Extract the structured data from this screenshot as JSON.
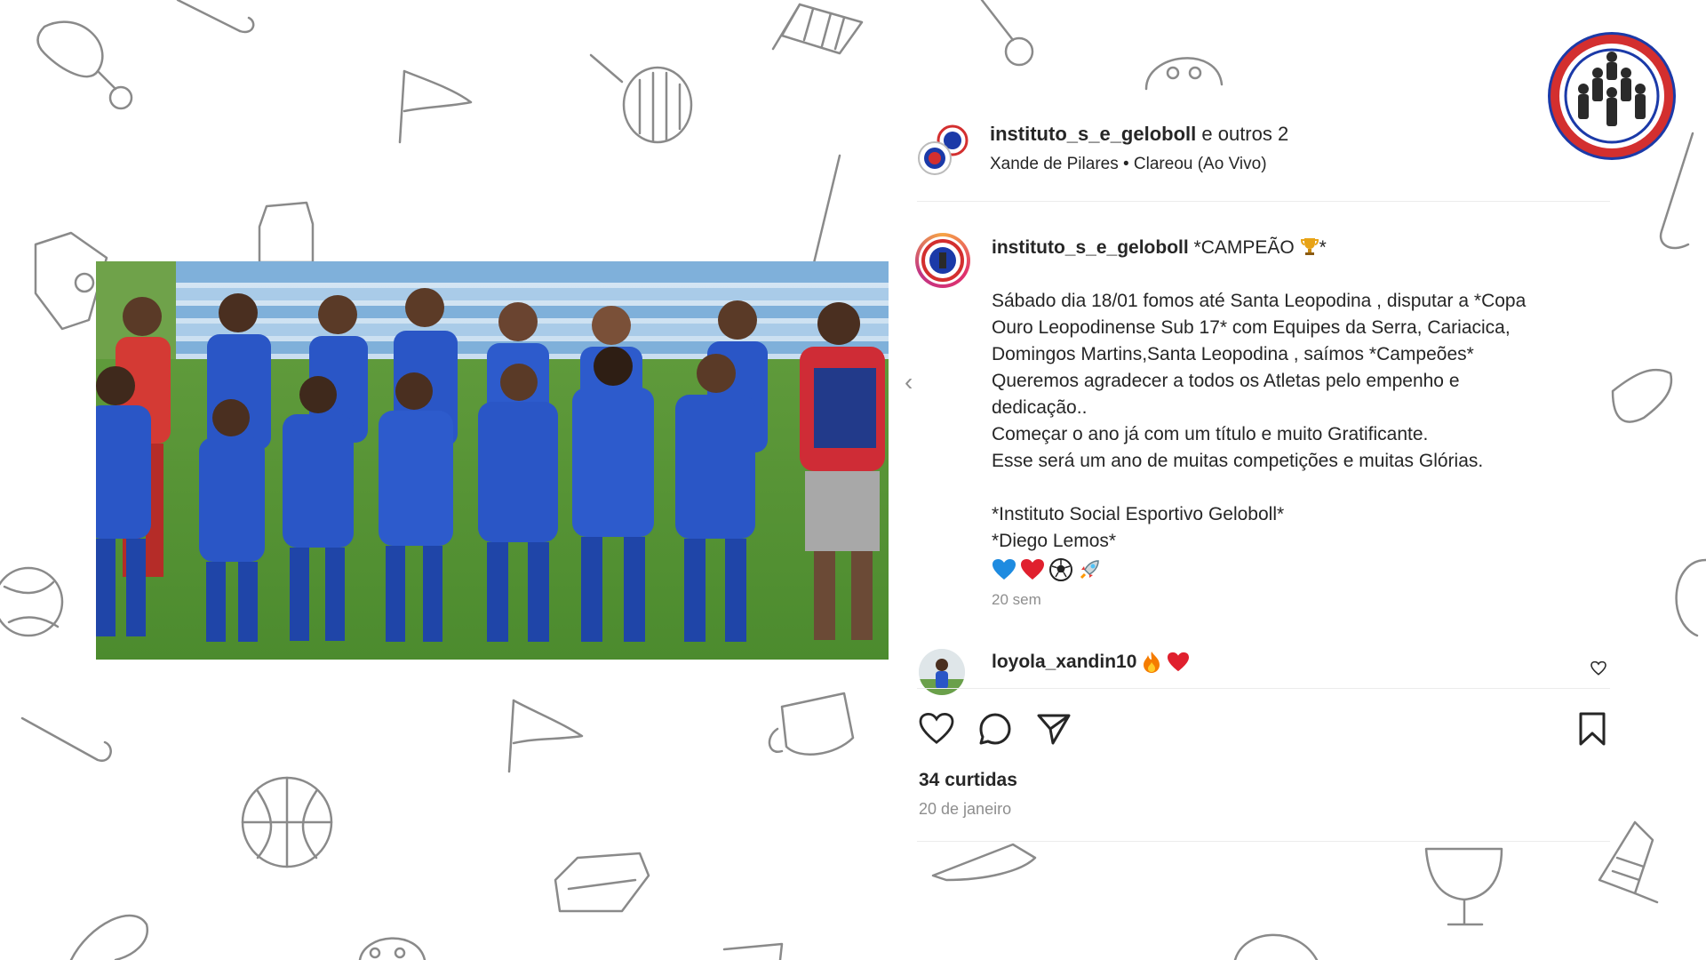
{
  "post": {
    "header_username": "instituto_s_e_geloboll",
    "header_others": " e outros 2",
    "music": "Xande de Pilares • Clareou (Ao Vivo)"
  },
  "caption": {
    "username": "instituto_s_e_geloboll",
    "title": " *CAMPEÃO",
    "title_end": "*",
    "lines": [
      "Sábado dia 18/01 fomos até Santa Leopodina , disputar a *Copa",
      "Ouro Leopodinense Sub 17* com Equipes da Serra, Cariacica,",
      "Domingos Martins,Santa Leopodina , saímos *Campeões*",
      "Queremos agradecer a todos os Atletas pelo empenho e",
      "dedicação..",
      "Começar o ano já com um título e muito Gratificante.",
      "Esse será um ano de muitas competições e muitas Glórias.",
      "",
      "*Instituto Social Esportivo Geloboll*",
      "*Diego Lemos*"
    ],
    "emoji_icons": [
      "blue-heart-icon",
      "red-heart-icon",
      "soccer-ball-icon",
      "rocket-icon"
    ],
    "time": "20 sem"
  },
  "comment": {
    "username": "loyola_xandin10",
    "emoji_icons": [
      "fire-icon",
      "red-heart-icon"
    ]
  },
  "stats": {
    "likes": "34 curtidas",
    "date": "20 de janeiro"
  },
  "colors": {
    "team_blue": "#2a56c6",
    "logo_border": "#d32f2f",
    "logo_ring": "#1b3aa8",
    "doodle_stroke": "#8a8a8a"
  }
}
